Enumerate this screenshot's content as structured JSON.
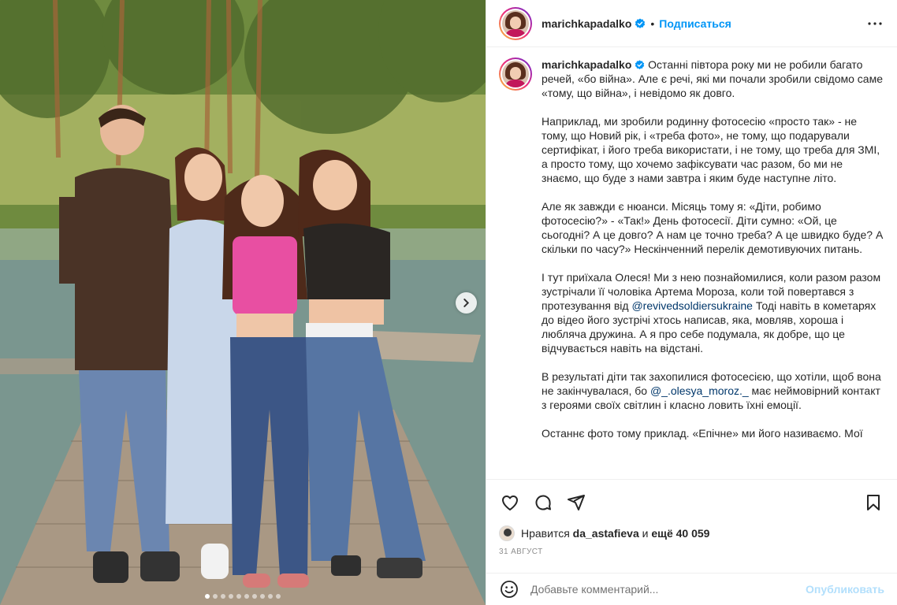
{
  "post": {
    "username": "marichkapadalko",
    "separator": "•",
    "follow_label": "Подписаться",
    "caption_paragraphs": [
      "Наприклад, ми зробили родинну фотосесію «просто так» - не тому, що Новий рік, і «треба фото», не тому, що подарували сертифікат, і його треба використати, і не тому, що треба для ЗМІ, а просто тому, що хочемо зафіксувати час разом, бо ми не знаємо, що буде з нами завтра і яким буде наступне літо.",
      "Але як завжди є нюанси. Місяць тому я: «Діти, робимо фотосесію?» - «Так!» День фотосесії. Діти сумно: «Ой, це сьогодні? А це довго? А нам це точно треба? А це швидко буде? А скільки по часу?» Нескінченний перелік демотивуючих питань."
    ],
    "caption_first": "Останні півтора року ми не робили багато речей, «бо війна». Але є речі, які ми почали зробили свідомо саме «тому, що війна», і невідомо як довго.",
    "caption_p3_a": "І тут приїхала Олеся! Ми з нею познайомилися, коли разом разом зустрічали її чоловіка Артема Мороза, коли той повертався з протезування від ",
    "caption_p3_mention": "@revivedsoldiersukraine",
    "caption_p3_b": " Тоді навіть в кометарях до відео його зустрічі хтось написав, яка, мовляв, хороша і любляча дружина. А я про себе подумала, як добре, що це відчувається навіть на відстані.",
    "caption_p4_a": "В результаті діти так захопилися фотосесією, що хотіли, щоб вона не закінчувалася, бо ",
    "caption_p4_mention": "@_.olesya_moroz._",
    "caption_p4_b": " має неймовірний контакт з героями своїх світлин і класно ловить їхні емоції.",
    "caption_p5": "Останнє фото тому приклад. «Епічне» ми його називаємо. Мої",
    "likes_prefix": "Нравится",
    "likes_user": "da_astafieva",
    "likes_and": "и",
    "likes_more": "ещё 40 059",
    "date": "31 август",
    "comment_placeholder": "Добавьте комментарий...",
    "publish_label": "Опубликовать"
  },
  "carousel": {
    "slides": 10,
    "active_index": 0
  },
  "icons": {
    "verified": "verified-badge-icon",
    "more": "more-options-icon",
    "like": "heart-icon",
    "comment": "comment-icon",
    "share": "paper-plane-icon",
    "save": "bookmark-icon",
    "emoji": "smiley-icon",
    "next": "chevron-right-icon"
  },
  "colors": {
    "link": "#0095f6",
    "mention": "#00376b",
    "muted": "#8e8e8e",
    "publish_disabled": "#b2dffc"
  }
}
